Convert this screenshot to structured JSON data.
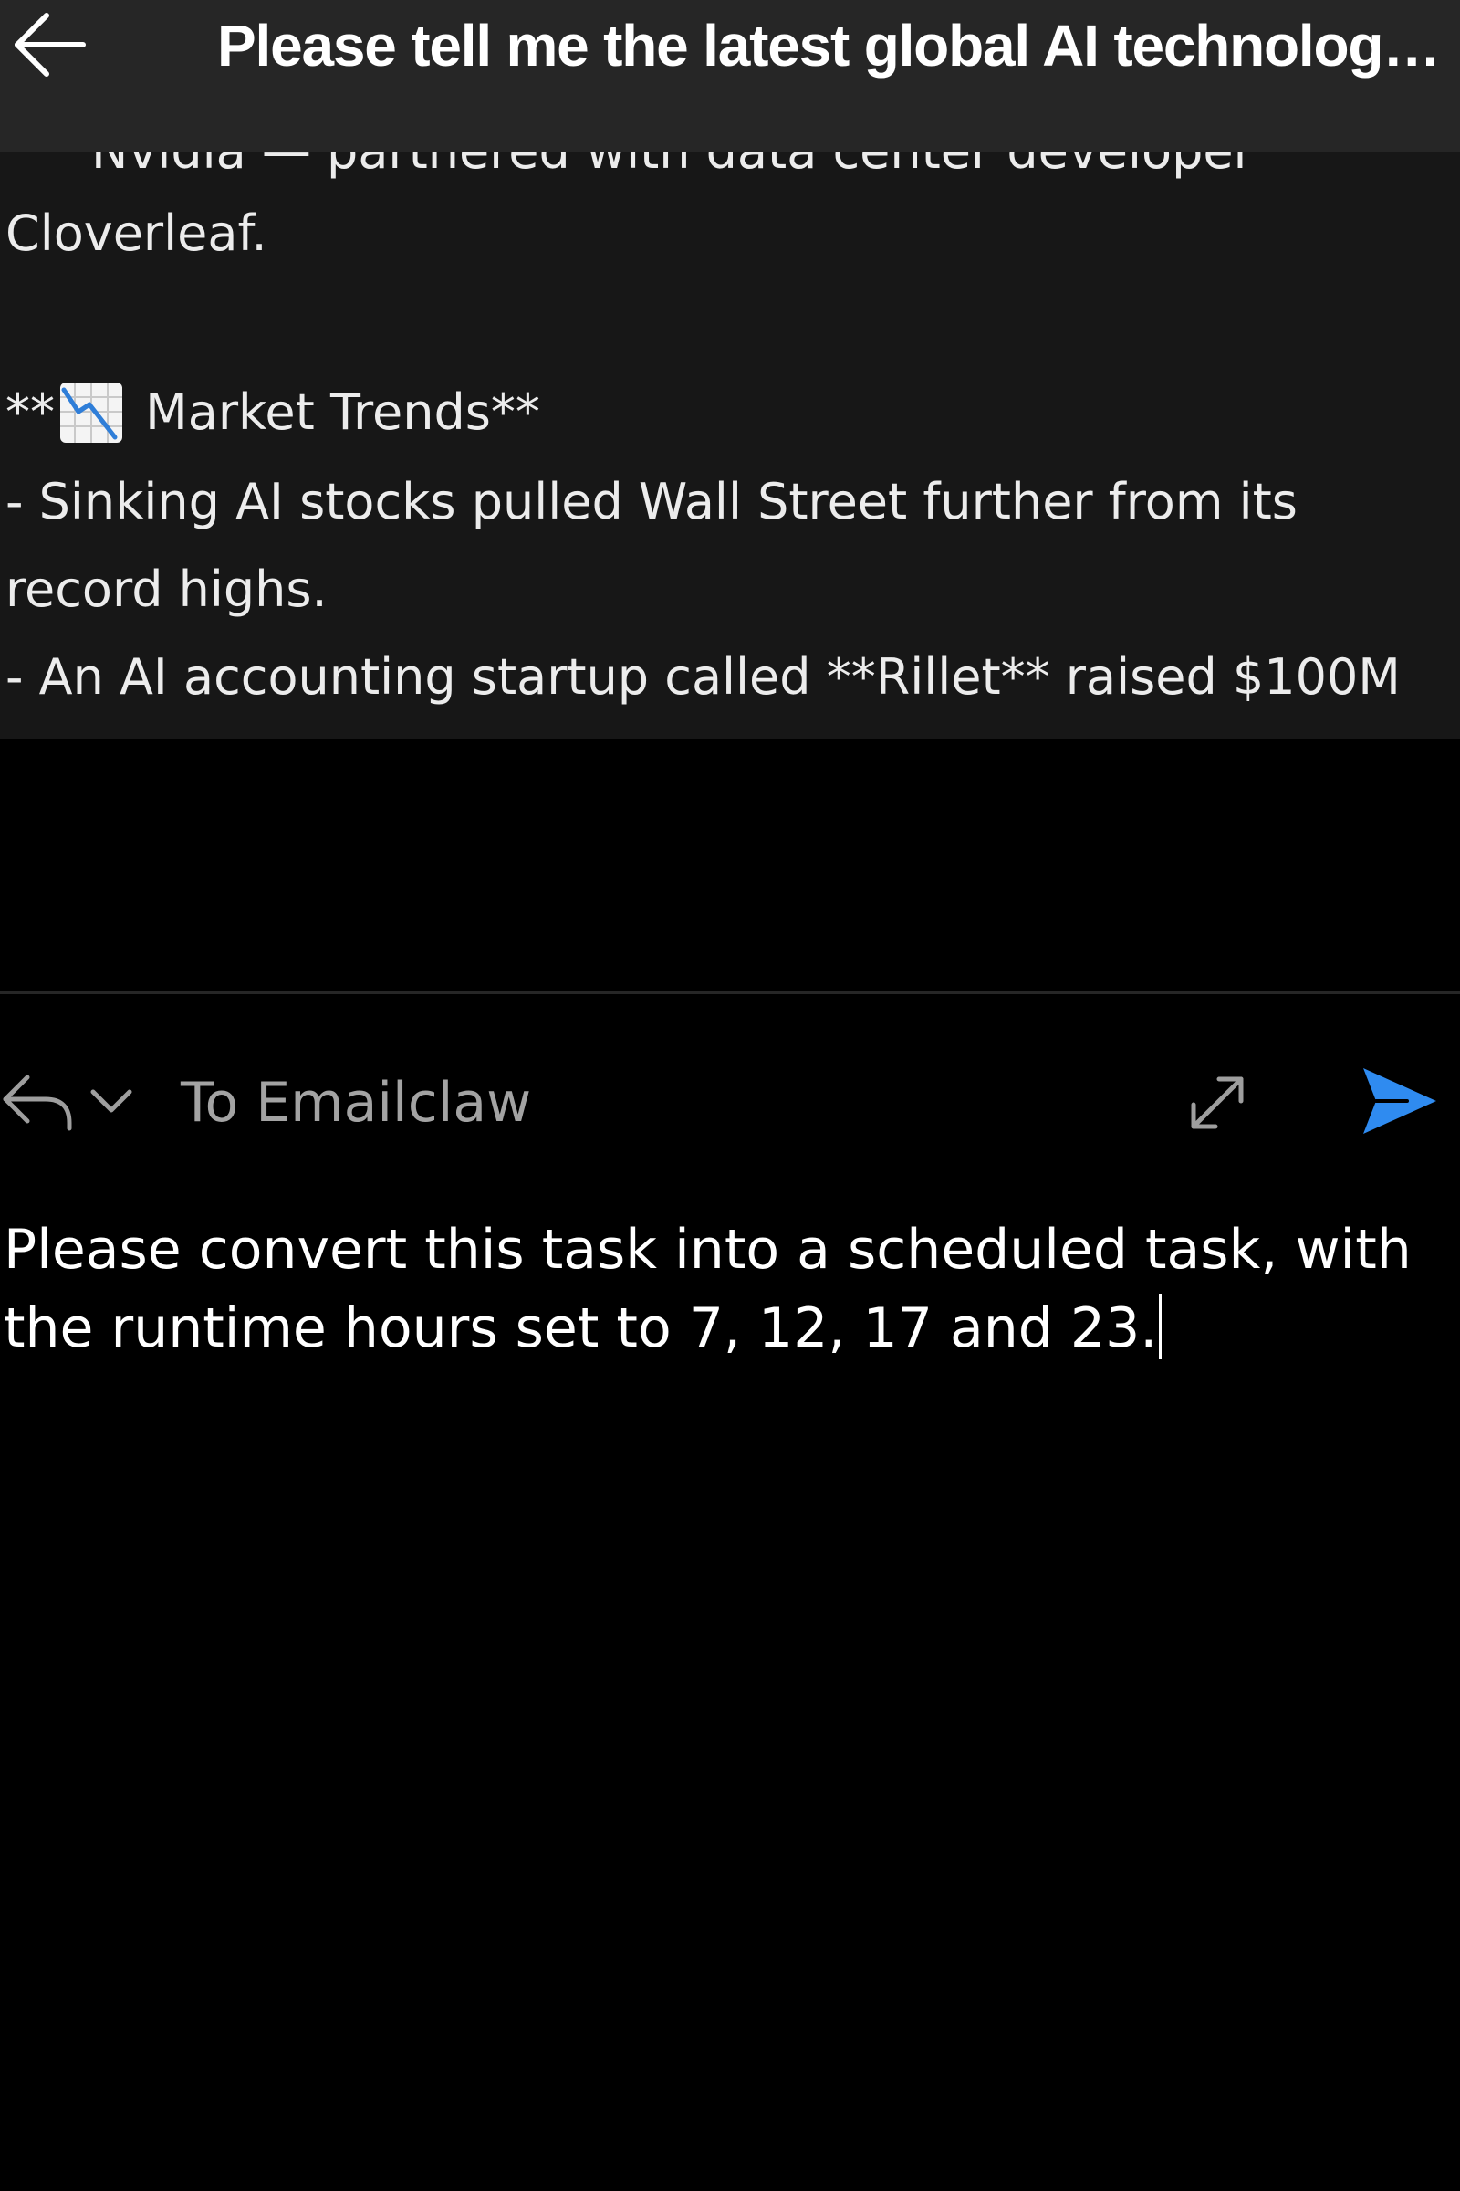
{
  "header": {
    "title": "Please tell me the latest global AI technology news",
    "back_icon": "arrow-left-icon"
  },
  "message": {
    "cut_line": "Nvidia — partnered with data center developer",
    "line_1": "Cloverleaf.",
    "heading_prefix": "**",
    "heading_icon": "chart-decreasing-icon",
    "heading_text": " Market Trends**",
    "line_2": "- Sinking AI stocks pulled Wall Street further from its",
    "line_3": "record highs.",
    "line_4": "- An AI accounting startup called **Rillet** raised $100M"
  },
  "compose": {
    "reply_icon": "reply-icon",
    "dropdown_icon": "chevron-down-icon",
    "recipient": "To Emailclaw",
    "expand_icon": "expand-icon",
    "send_icon": "send-icon",
    "text": "Please convert this task into a scheduled task, with the runtime hours set to 7, 12, 17 and 23."
  },
  "colors": {
    "background": "#000000",
    "header": "#262626",
    "message_panel": "#171717",
    "send_accent": "#2f8bf0",
    "muted_text": "#a3a3a3"
  }
}
